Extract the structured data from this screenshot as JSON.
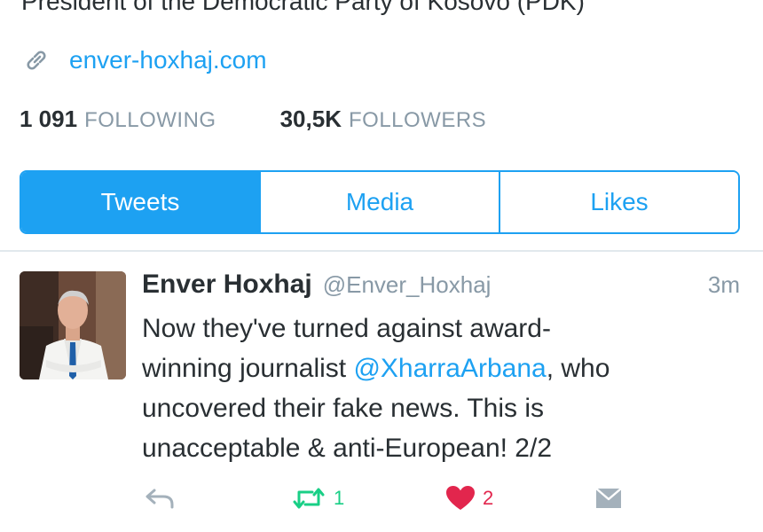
{
  "profile": {
    "bio": "President of the Democratic Party of Kosovo (PDK)",
    "website": "enver-hoxhaj.com",
    "following_count": "1 091",
    "following_label": "FOLLOWING",
    "followers_count": "30,5K",
    "followers_label": "FOLLOWERS"
  },
  "tabs": [
    {
      "label": "Tweets",
      "active": true
    },
    {
      "label": "Media",
      "active": false
    },
    {
      "label": "Likes",
      "active": false
    }
  ],
  "tweet": {
    "author_name": "Enver Hoxhaj",
    "author_handle": "@Enver_Hoxhaj",
    "timestamp": "3m",
    "text_lines": [
      "Now they've turned against award-",
      {
        "pre": "winning journalist ",
        "mention": "@XharraArbana",
        "post": ", who"
      },
      "uncovered their fake news. This is",
      "unacceptable & anti-European! 2/2"
    ],
    "retweet_count": "1",
    "like_count": "2"
  },
  "icons": {
    "link": "link-icon",
    "reply": "reply-icon",
    "retweet": "retweet-icon",
    "like": "heart-icon",
    "dm": "direct-message-icon"
  },
  "colors": {
    "accent": "#1da1f2",
    "retweet": "#19cf86",
    "like": "#e2264d",
    "muted": "#8899a6"
  }
}
